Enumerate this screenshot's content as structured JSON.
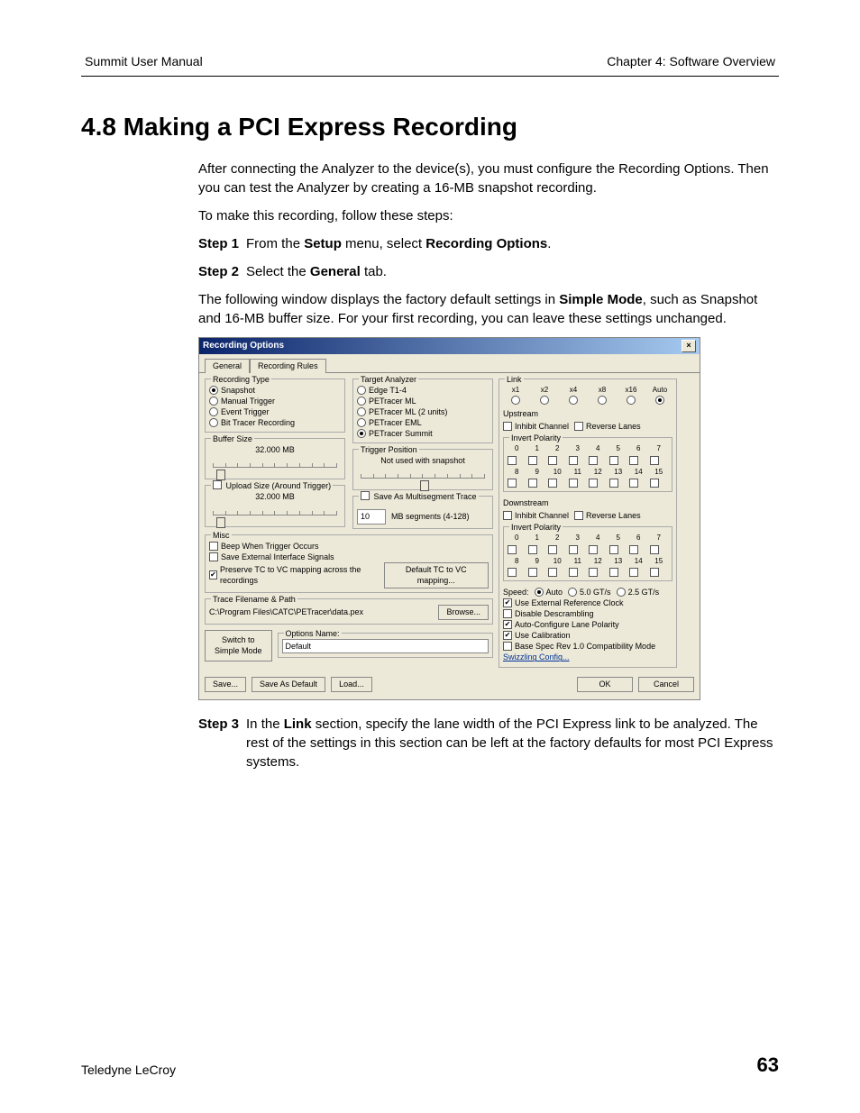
{
  "header": {
    "left": "Summit User Manual",
    "right": "Chapter 4: Software Overview"
  },
  "title": "4.8 Making a PCI Express Recording",
  "para1": "After connecting the Analyzer to the device(s), you must configure the Recording Options. Then you can test the Analyzer by creating a 16-MB snapshot recording.",
  "para2": "To make this recording, follow these steps:",
  "step1": {
    "lbl": "Step 1",
    "a": "From the ",
    "b": "Setup",
    "c": " menu, select ",
    "d": "Recording Options",
    "e": "."
  },
  "step2": {
    "lbl": "Step 2",
    "a": "Select the ",
    "b": "General",
    "c": " tab."
  },
  "step2note": {
    "a": "The following window displays the factory default settings in ",
    "b": "Simple Mode",
    "c": ", such as Snapshot and 16-MB buffer size. For your first recording, you can leave these settings unchanged."
  },
  "step3": {
    "lbl": "Step 3",
    "a": "In the ",
    "b": "Link",
    "c": " section, specify the lane width of the PCI Express link to be analyzed. The rest of the settings in this section can be left at the factory defaults for most PCI Express systems."
  },
  "footer": {
    "left": "Teledyne LeCroy",
    "page": "63"
  },
  "dlg": {
    "title": "Recording Options",
    "tabs": [
      "General",
      "Recording Rules"
    ],
    "rectype": {
      "legend": "Recording Type",
      "opts": [
        "Snapshot",
        "Manual Trigger",
        "Event Trigger",
        "Bit Tracer Recording"
      ]
    },
    "buffer": {
      "legend": "Buffer Size",
      "val": "32.000 MB"
    },
    "upload": {
      "legend": "Upload Size (Around Trigger)",
      "val": "32.000 MB"
    },
    "misc": {
      "legend": "Misc",
      "beep": "Beep When Trigger Occurs",
      "save": "Save External Interface Signals",
      "pres": "Preserve TC to VC mapping across the recordings",
      "btn": "Default TC to VC mapping..."
    },
    "target": {
      "legend": "Target Analyzer",
      "opts": [
        "Edge T1-4",
        "PETracer ML",
        "PETracer ML (2 units)",
        "PETracer EML",
        "PETracer Summit"
      ]
    },
    "trigpos": {
      "legend": "Trigger Position",
      "note": "Not used with snapshot"
    },
    "multiseg": {
      "legend": "Save As Multisegment Trace",
      "val": "10",
      "suffix": "MB segments (4-128)"
    },
    "trace": {
      "legend": "Trace Filename & Path",
      "path": "C:\\Program Files\\CATC\\PETracer\\data.pex",
      "browse": "Browse..."
    },
    "switch": {
      "btn": "Switch to\nSimple Mode",
      "optlbl": "Options Name:",
      "optval": "Default"
    },
    "link": {
      "legend": "Link",
      "widths": [
        "x1",
        "x2",
        "x4",
        "x8",
        "x16",
        "Auto"
      ],
      "up": "Upstream",
      "down": "Downstream",
      "inhibit": "Inhibit Channel",
      "reverse": "Reverse Lanes",
      "invert": "Invert Polarity",
      "speedlbl": "Speed:",
      "speeds": [
        "Auto",
        "5.0 GT/s",
        "2.5 GT/s"
      ],
      "opts": [
        "Use External Reference Clock",
        "Disable Descrambling",
        "Auto-Configure Lane Polarity",
        "Use Calibration",
        "Base Spec Rev 1.0 Compatibility Mode"
      ],
      "sw": "Swizzling Config..."
    },
    "btm": {
      "save": "Save...",
      "savedef": "Save As Default",
      "load": "Load...",
      "ok": "OK",
      "cancel": "Cancel"
    }
  }
}
